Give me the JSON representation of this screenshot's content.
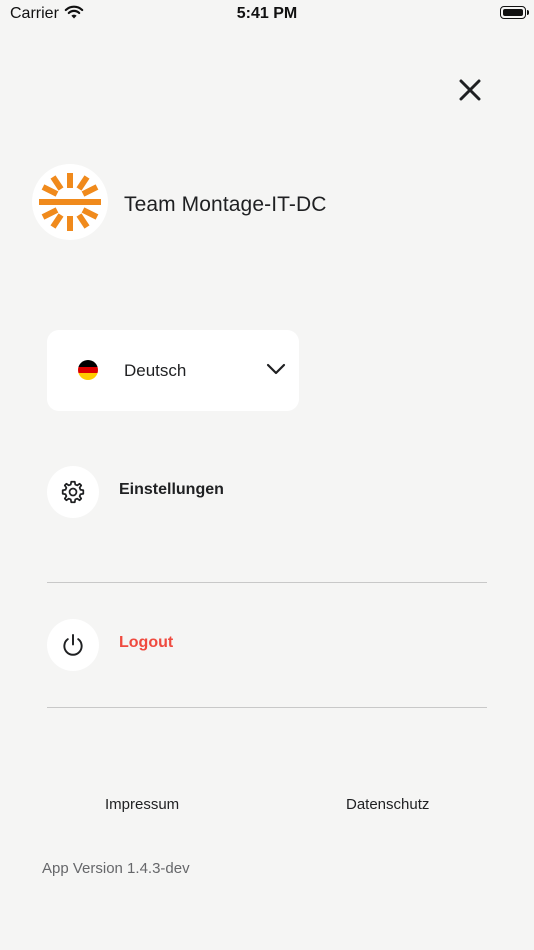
{
  "status_bar": {
    "carrier": "Carrier",
    "time": "5:41 PM",
    "wifi_icon": "wifi-icon",
    "battery_icon": "battery-icon"
  },
  "header": {
    "close_icon": "close-icon"
  },
  "team": {
    "name": "Team Montage-IT-DC",
    "logo_color": "#f08a1c"
  },
  "language": {
    "selected": "Deutsch",
    "flag_icon": "german-flag-icon",
    "chevron_icon": "chevron-down-icon"
  },
  "menu": {
    "settings": {
      "label": "Einstellungen",
      "icon": "gear-icon"
    },
    "logout": {
      "label": "Logout",
      "icon": "power-icon",
      "color": "#ef4a3f"
    }
  },
  "footer": {
    "impressum": "Impressum",
    "datenschutz": "Datenschutz",
    "app_version": "App Version 1.4.3-dev"
  }
}
